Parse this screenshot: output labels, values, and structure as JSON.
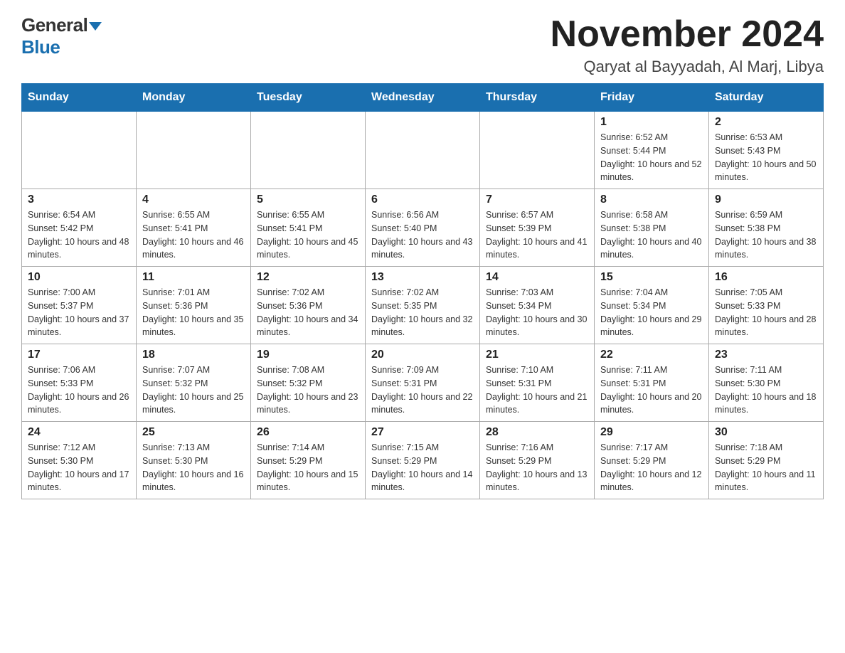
{
  "logo": {
    "general": "General",
    "blue": "Blue"
  },
  "header": {
    "month": "November 2024",
    "location": "Qaryat al Bayyadah, Al Marj, Libya"
  },
  "weekdays": [
    "Sunday",
    "Monday",
    "Tuesday",
    "Wednesday",
    "Thursday",
    "Friday",
    "Saturday"
  ],
  "weeks": [
    [
      {
        "day": "",
        "sunrise": "",
        "sunset": "",
        "daylight": ""
      },
      {
        "day": "",
        "sunrise": "",
        "sunset": "",
        "daylight": ""
      },
      {
        "day": "",
        "sunrise": "",
        "sunset": "",
        "daylight": ""
      },
      {
        "day": "",
        "sunrise": "",
        "sunset": "",
        "daylight": ""
      },
      {
        "day": "",
        "sunrise": "",
        "sunset": "",
        "daylight": ""
      },
      {
        "day": "1",
        "sunrise": "Sunrise: 6:52 AM",
        "sunset": "Sunset: 5:44 PM",
        "daylight": "Daylight: 10 hours and 52 minutes."
      },
      {
        "day": "2",
        "sunrise": "Sunrise: 6:53 AM",
        "sunset": "Sunset: 5:43 PM",
        "daylight": "Daylight: 10 hours and 50 minutes."
      }
    ],
    [
      {
        "day": "3",
        "sunrise": "Sunrise: 6:54 AM",
        "sunset": "Sunset: 5:42 PM",
        "daylight": "Daylight: 10 hours and 48 minutes."
      },
      {
        "day": "4",
        "sunrise": "Sunrise: 6:55 AM",
        "sunset": "Sunset: 5:41 PM",
        "daylight": "Daylight: 10 hours and 46 minutes."
      },
      {
        "day": "5",
        "sunrise": "Sunrise: 6:55 AM",
        "sunset": "Sunset: 5:41 PM",
        "daylight": "Daylight: 10 hours and 45 minutes."
      },
      {
        "day": "6",
        "sunrise": "Sunrise: 6:56 AM",
        "sunset": "Sunset: 5:40 PM",
        "daylight": "Daylight: 10 hours and 43 minutes."
      },
      {
        "day": "7",
        "sunrise": "Sunrise: 6:57 AM",
        "sunset": "Sunset: 5:39 PM",
        "daylight": "Daylight: 10 hours and 41 minutes."
      },
      {
        "day": "8",
        "sunrise": "Sunrise: 6:58 AM",
        "sunset": "Sunset: 5:38 PM",
        "daylight": "Daylight: 10 hours and 40 minutes."
      },
      {
        "day": "9",
        "sunrise": "Sunrise: 6:59 AM",
        "sunset": "Sunset: 5:38 PM",
        "daylight": "Daylight: 10 hours and 38 minutes."
      }
    ],
    [
      {
        "day": "10",
        "sunrise": "Sunrise: 7:00 AM",
        "sunset": "Sunset: 5:37 PM",
        "daylight": "Daylight: 10 hours and 37 minutes."
      },
      {
        "day": "11",
        "sunrise": "Sunrise: 7:01 AM",
        "sunset": "Sunset: 5:36 PM",
        "daylight": "Daylight: 10 hours and 35 minutes."
      },
      {
        "day": "12",
        "sunrise": "Sunrise: 7:02 AM",
        "sunset": "Sunset: 5:36 PM",
        "daylight": "Daylight: 10 hours and 34 minutes."
      },
      {
        "day": "13",
        "sunrise": "Sunrise: 7:02 AM",
        "sunset": "Sunset: 5:35 PM",
        "daylight": "Daylight: 10 hours and 32 minutes."
      },
      {
        "day": "14",
        "sunrise": "Sunrise: 7:03 AM",
        "sunset": "Sunset: 5:34 PM",
        "daylight": "Daylight: 10 hours and 30 minutes."
      },
      {
        "day": "15",
        "sunrise": "Sunrise: 7:04 AM",
        "sunset": "Sunset: 5:34 PM",
        "daylight": "Daylight: 10 hours and 29 minutes."
      },
      {
        "day": "16",
        "sunrise": "Sunrise: 7:05 AM",
        "sunset": "Sunset: 5:33 PM",
        "daylight": "Daylight: 10 hours and 28 minutes."
      }
    ],
    [
      {
        "day": "17",
        "sunrise": "Sunrise: 7:06 AM",
        "sunset": "Sunset: 5:33 PM",
        "daylight": "Daylight: 10 hours and 26 minutes."
      },
      {
        "day": "18",
        "sunrise": "Sunrise: 7:07 AM",
        "sunset": "Sunset: 5:32 PM",
        "daylight": "Daylight: 10 hours and 25 minutes."
      },
      {
        "day": "19",
        "sunrise": "Sunrise: 7:08 AM",
        "sunset": "Sunset: 5:32 PM",
        "daylight": "Daylight: 10 hours and 23 minutes."
      },
      {
        "day": "20",
        "sunrise": "Sunrise: 7:09 AM",
        "sunset": "Sunset: 5:31 PM",
        "daylight": "Daylight: 10 hours and 22 minutes."
      },
      {
        "day": "21",
        "sunrise": "Sunrise: 7:10 AM",
        "sunset": "Sunset: 5:31 PM",
        "daylight": "Daylight: 10 hours and 21 minutes."
      },
      {
        "day": "22",
        "sunrise": "Sunrise: 7:11 AM",
        "sunset": "Sunset: 5:31 PM",
        "daylight": "Daylight: 10 hours and 20 minutes."
      },
      {
        "day": "23",
        "sunrise": "Sunrise: 7:11 AM",
        "sunset": "Sunset: 5:30 PM",
        "daylight": "Daylight: 10 hours and 18 minutes."
      }
    ],
    [
      {
        "day": "24",
        "sunrise": "Sunrise: 7:12 AM",
        "sunset": "Sunset: 5:30 PM",
        "daylight": "Daylight: 10 hours and 17 minutes."
      },
      {
        "day": "25",
        "sunrise": "Sunrise: 7:13 AM",
        "sunset": "Sunset: 5:30 PM",
        "daylight": "Daylight: 10 hours and 16 minutes."
      },
      {
        "day": "26",
        "sunrise": "Sunrise: 7:14 AM",
        "sunset": "Sunset: 5:29 PM",
        "daylight": "Daylight: 10 hours and 15 minutes."
      },
      {
        "day": "27",
        "sunrise": "Sunrise: 7:15 AM",
        "sunset": "Sunset: 5:29 PM",
        "daylight": "Daylight: 10 hours and 14 minutes."
      },
      {
        "day": "28",
        "sunrise": "Sunrise: 7:16 AM",
        "sunset": "Sunset: 5:29 PM",
        "daylight": "Daylight: 10 hours and 13 minutes."
      },
      {
        "day": "29",
        "sunrise": "Sunrise: 7:17 AM",
        "sunset": "Sunset: 5:29 PM",
        "daylight": "Daylight: 10 hours and 12 minutes."
      },
      {
        "day": "30",
        "sunrise": "Sunrise: 7:18 AM",
        "sunset": "Sunset: 5:29 PM",
        "daylight": "Daylight: 10 hours and 11 minutes."
      }
    ]
  ]
}
